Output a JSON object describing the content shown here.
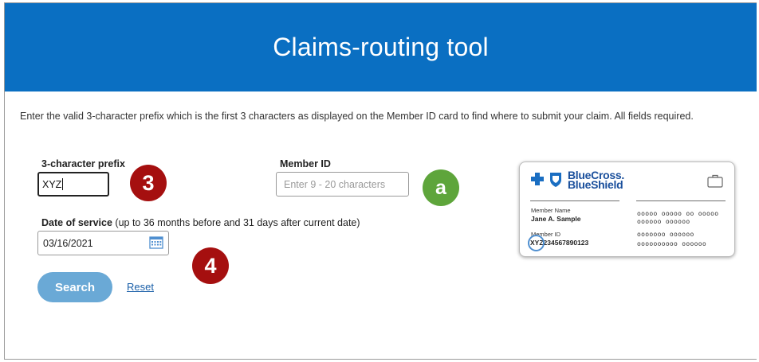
{
  "header": {
    "title": "Claims-routing tool",
    "bg_color": "#0a6fc2"
  },
  "intro": "Enter the valid 3-character prefix which is the first 3 characters as displayed on the Member ID card to find where to submit your claim. All fields required.",
  "form": {
    "prefix": {
      "label": "3-character prefix",
      "value": "XYZ"
    },
    "member_id": {
      "label": "Member ID",
      "placeholder": "Enter 9 - 20 characters"
    },
    "date": {
      "label": "Date of service",
      "label_note": "(up to 36 months before and 31 days after current date)",
      "value": "03/16/2021",
      "icon": "calendar-icon"
    },
    "search_label": "Search",
    "reset_label": "Reset"
  },
  "annotations": {
    "prefix": "3",
    "date": "4",
    "member": "a"
  },
  "card": {
    "brand_line1": "BlueCross.",
    "brand_line2": "BlueShield",
    "member_name_label": "Member Name",
    "member_name": "Jane A. Sample",
    "member_id_label": "Member ID",
    "member_id": "XYZ234567890123",
    "redacted": [
      "ooooo ooooo oo ooooo",
      "oooooo oooooo",
      "ooooooo oooooo",
      "oooooooooo oooooo"
    ]
  },
  "colors": {
    "accent": "#0a6fc2",
    "button": "#6aa9d6",
    "badge_red": "#a50f0f",
    "badge_green": "#5ea53b"
  }
}
